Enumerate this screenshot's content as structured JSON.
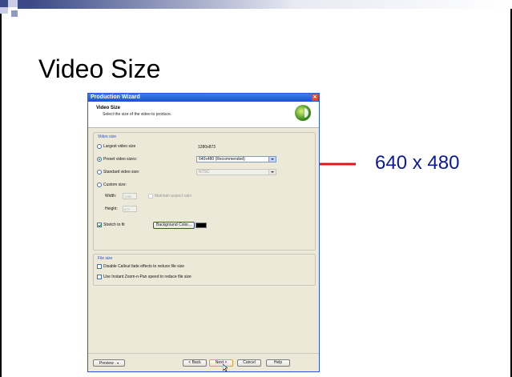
{
  "slide": {
    "title": "Video Size",
    "callout": "640 x 480"
  },
  "colors": {
    "deco_dark": "#3b4a86",
    "deco_mid": "#8f9ac4",
    "deco_light": "#c9cde6",
    "arrow": "#e0161a",
    "callout": "#0a1a9a"
  },
  "dialog": {
    "window_title": "Production Wizard",
    "close_glyph": "✕",
    "header_title": "Video Size",
    "header_subtitle": "Select the size of the video to produce.",
    "video_size": {
      "group_label": "Video size",
      "largest_label": "Largest video size",
      "largest_value": "1280x873",
      "preset_label": "Preset video sizes:",
      "preset_selected": "640x480 (Recommended)",
      "standard_label": "Standard video size:",
      "standard_selected": "NTSC",
      "custom_label": "Custom size:",
      "width_label": "Width:",
      "width_value": "1280",
      "height_label": "Height:",
      "height_value": "873",
      "aspect_label": "Maintain aspect ratio",
      "stretch_label": "Stretch to fit",
      "background_button": "Background Color..."
    },
    "file_size": {
      "group_label": "File size",
      "callout_fade_label": "Disable Callout fade effects to reduce file size",
      "zoom_pan_label": "Use Instant Zoom-n-Pan speed to reduce file size"
    },
    "buttons": {
      "preview": "Preview",
      "back": "< Back",
      "next": "Next >",
      "cancel": "Cancel",
      "help": "Help"
    }
  }
}
